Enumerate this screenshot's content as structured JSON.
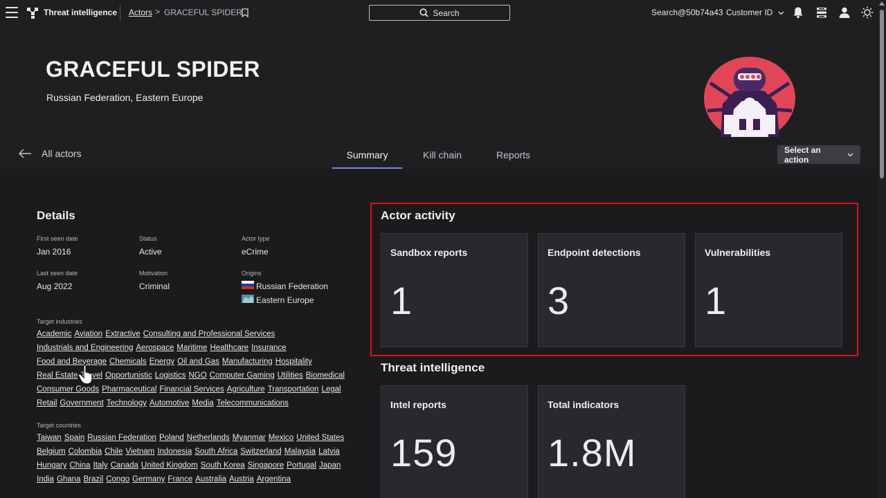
{
  "topbar": {
    "app_title": "Threat intelligence",
    "breadcrumb_parent": "Actors",
    "breadcrumb_separator": ">",
    "breadcrumb_current": "GRACEFUL SPIDER",
    "search_label": "Search",
    "user": "Search@50b74a43",
    "customer_id": "Customer ID"
  },
  "actor": {
    "name": "GRACEFUL SPIDER",
    "origin": "Russian Federation, Eastern Europe"
  },
  "nav": {
    "back_label": "All actors",
    "tabs": [
      "Summary",
      "Kill chain",
      "Reports"
    ],
    "active_tab": "Summary",
    "select_action": "Select an action"
  },
  "details": {
    "title": "Details",
    "first_seen_label": "First seen date",
    "first_seen": "Jan 2016",
    "status_label": "Status",
    "status": "Active",
    "actor_type_label": "Actor type",
    "actor_type": "eCrime",
    "last_seen_label": "Last seen date",
    "last_seen": "Aug 2022",
    "motivation_label": "Motivation",
    "motivation": "Criminal",
    "origins_label": "Origins",
    "origins": [
      "Russian Federation",
      "Eastern Europe"
    ],
    "industries_label": "Target industries",
    "industries": [
      [
        "Academic",
        "Aviation",
        "Extractive",
        "Consulting and Professional Services"
      ],
      [
        "Industrials and Engineering",
        "Aerospace",
        "Maritime",
        "Healthcare",
        "Insurance"
      ],
      [
        "Food and Beverage",
        "Chemicals",
        "Energy",
        "Oil and Gas",
        "Manufacturing",
        "Hospitality"
      ],
      [
        "Real Estate",
        "Travel",
        "Opportunistic",
        "Logistics",
        "NGO",
        "Computer Gaming",
        "Utilities",
        "Biomedical"
      ],
      [
        "Consumer Goods",
        "Pharmaceutical",
        "Financial Services",
        "Agriculture",
        "Transportation",
        "Legal"
      ],
      [
        "Retail",
        "Government",
        "Technology",
        "Automotive",
        "Media",
        "Telecommunications"
      ]
    ],
    "countries_label": "Target countries",
    "countries": [
      [
        "Taiwan",
        "Spain",
        "Russian Federation",
        "Poland",
        "Netherlands",
        "Myanmar",
        "Mexico",
        "United States"
      ],
      [
        "Belgium",
        "Colombia",
        "Chile",
        "Vietnam",
        "Indonesia",
        "South Africa",
        "Switzerland",
        "Malaysia",
        "Latvia"
      ],
      [
        "Hungary",
        "China",
        "Italy",
        "Canada",
        "United Kingdom",
        "South Korea",
        "Singapore",
        "Portugal",
        "Japan"
      ],
      [
        "India",
        "Ghana",
        "Brazil",
        "Congo",
        "Germany",
        "France",
        "Australia",
        "Austria",
        "Argentina"
      ]
    ]
  },
  "actor_activity": {
    "title": "Actor activity",
    "cards": [
      {
        "label": "Sandbox reports",
        "value": "1"
      },
      {
        "label": "Endpoint detections",
        "value": "3"
      },
      {
        "label": "Vulnerabilities",
        "value": "1"
      }
    ]
  },
  "threat_intel": {
    "title": "Threat intelligence",
    "cards": [
      {
        "label": "Intel reports",
        "value": "159"
      },
      {
        "label": "Total indicators",
        "value": "1.8M"
      }
    ]
  },
  "colors": {
    "background": "#1f1f22",
    "content_bg": "#1b1b1e",
    "card_bg": "#29292d",
    "accent": "#7b86e6",
    "highlight": "#e0101c"
  },
  "icons": [
    "menu-icon",
    "logo-icon",
    "bookmark-icon",
    "search-icon",
    "chevron-down-icon",
    "bell-icon",
    "apps-icon",
    "user-icon",
    "sun-icon",
    "arrow-left-icon"
  ]
}
